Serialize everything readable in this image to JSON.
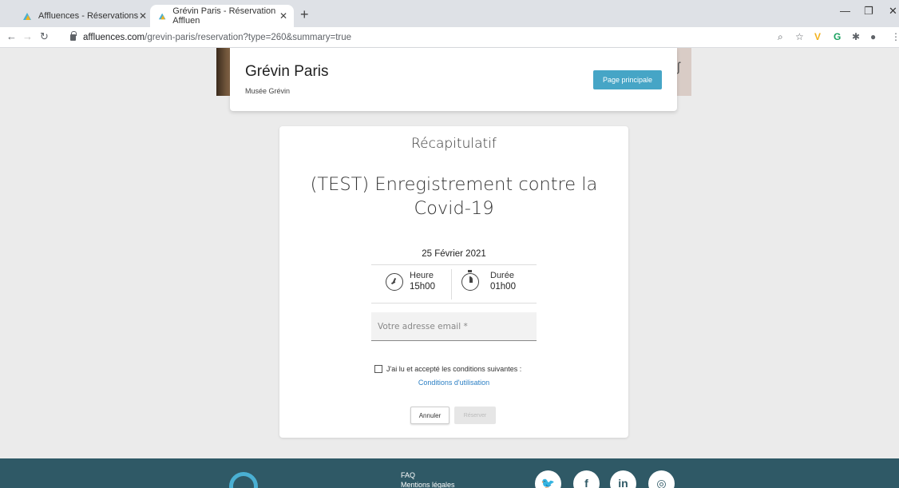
{
  "browser": {
    "tabs": [
      {
        "title": "Affluences - Réservations"
      },
      {
        "title": "Grévin Paris - Réservation Affluen"
      }
    ],
    "url_domain": "affluences.com",
    "url_path": "/grevin-paris/reservation?type=260&summary=true"
  },
  "header": {
    "title": "Grévin Paris",
    "subtitle": "Musée Grévin",
    "main_button": "Page principale"
  },
  "summary": {
    "title": "Récapitulatif",
    "event": "(TEST) Enregistrement contre la Covid-19",
    "date": "25 Février 2021",
    "time_label": "Heure",
    "time_value": "15h00",
    "duration_label": "Durée",
    "duration_value": "01h00",
    "email_placeholder": "Votre adresse email *",
    "consent_label": "J'ai lu et accepté les conditions suivantes :",
    "terms_link": "Conditions d'utilisation",
    "cancel_button": "Annuler",
    "book_button": "Réserver"
  },
  "footer": {
    "links": [
      "FAQ",
      "Mentions légales"
    ],
    "social": [
      "twitter",
      "facebook",
      "linkedin",
      "instagram"
    ]
  },
  "colors": {
    "accent": "#46a5c6",
    "footer_bg": "#2f5966",
    "link": "#2b7fc4"
  }
}
